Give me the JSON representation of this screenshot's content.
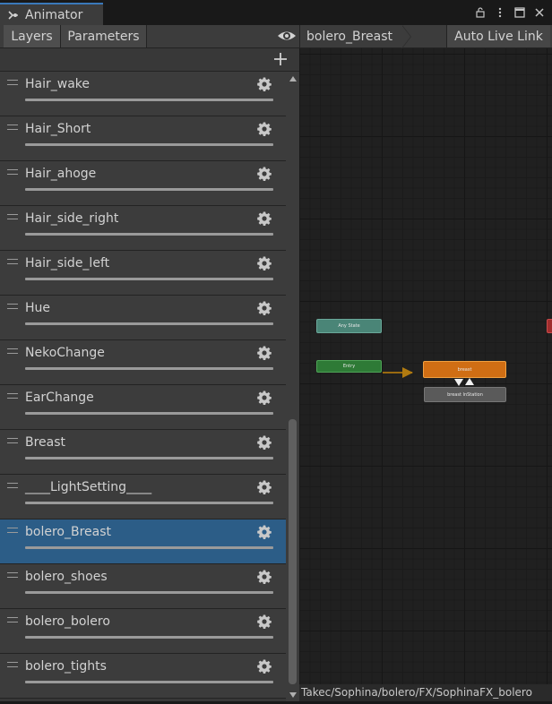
{
  "window": {
    "tab_title": "Animator"
  },
  "toolbar": {
    "layers_label": "Layers",
    "parameters_label": "Parameters"
  },
  "graph_header": {
    "breadcrumb": "bolero_Breast",
    "auto_live_link": "Auto Live Link"
  },
  "layers": [
    {
      "name": "Hair_wake",
      "selected": false
    },
    {
      "name": "Hair_Short",
      "selected": false
    },
    {
      "name": "Hair_ahoge",
      "selected": false
    },
    {
      "name": "Hair_side_right",
      "selected": false
    },
    {
      "name": "Hair_side_left",
      "selected": false
    },
    {
      "name": "Hue",
      "selected": false
    },
    {
      "name": "NekoChange",
      "selected": false
    },
    {
      "name": "EarChange",
      "selected": false
    },
    {
      "name": "Breast",
      "selected": false
    },
    {
      "name": "____LightSetting____",
      "selected": false
    },
    {
      "name": "bolero_Breast",
      "selected": true
    },
    {
      "name": "bolero_shoes",
      "selected": false
    },
    {
      "name": "bolero_bolero",
      "selected": false
    },
    {
      "name": "bolero_tights",
      "selected": false
    }
  ],
  "graph": {
    "nodes": {
      "any_state": "Any State",
      "entry": "Entry",
      "breast": "breast",
      "breast_in_station": "breast InStation"
    }
  },
  "path": "Takec/Sophina/bolero/FX/SophinaFX_bolero",
  "colors": {
    "selected_row": "#2c5d87",
    "any_state_node": "#4a8577",
    "entry_node": "#2e7a36",
    "default_state_node": "#d06e14",
    "tab_accent": "#3a79bb"
  }
}
